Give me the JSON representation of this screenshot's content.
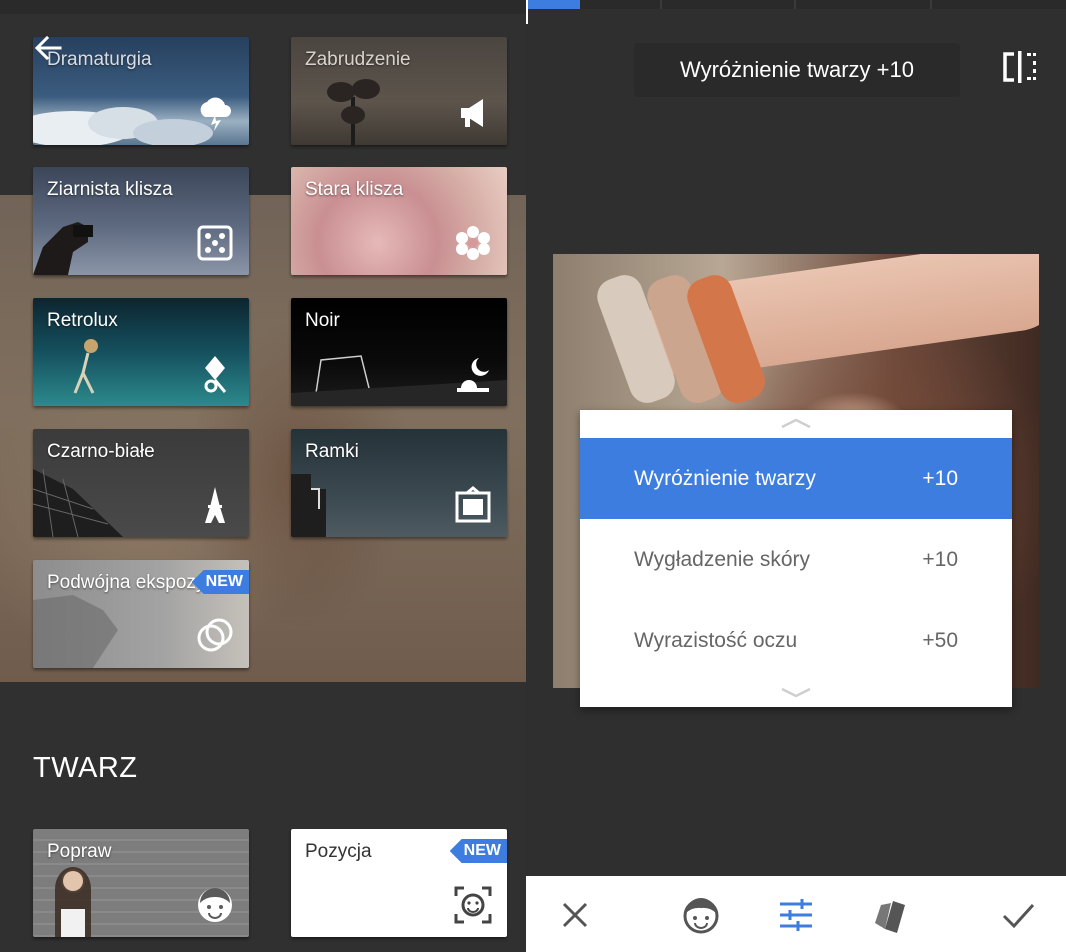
{
  "left": {
    "filters": [
      {
        "id": "dramaturgia",
        "label": "Dramaturgia",
        "icon": "cloud-lightning-icon"
      },
      {
        "id": "zabrudzenie",
        "label": "Zabrudzenie",
        "icon": "megaphone-icon"
      },
      {
        "id": "ziarnista",
        "label": "Ziarnista klisza",
        "icon": "dice-icon"
      },
      {
        "id": "stara",
        "label": "Stara klisza",
        "icon": "flower-icon"
      },
      {
        "id": "retrolux",
        "label": "Retrolux",
        "icon": "balloon-icon"
      },
      {
        "id": "noir",
        "label": "Noir",
        "icon": "moon-icon"
      },
      {
        "id": "czarno",
        "label": "Czarno-białe",
        "icon": "eiffel-tower-icon"
      },
      {
        "id": "ramki",
        "label": "Ramki",
        "icon": "frame-icon"
      },
      {
        "id": "podwojna",
        "label": "Podwójna ekspozycja",
        "icon": "overlap-circles-icon",
        "badge": "NEW"
      }
    ],
    "section_title": "TWARZ",
    "face_tools": [
      {
        "id": "popraw",
        "label": "Popraw",
        "icon": "face-icon"
      },
      {
        "id": "pozycja",
        "label": "Pozycja",
        "icon": "face-scan-icon",
        "badge": "NEW"
      }
    ]
  },
  "right": {
    "current_value": "Wyróżnienie twarzy +10",
    "menu": [
      {
        "label": "Wyróżnienie twarzy",
        "value": "+10",
        "active": true
      },
      {
        "label": "Wygładzenie skóry",
        "value": "+10",
        "active": false
      },
      {
        "label": "Wyrazistość oczu",
        "value": "+50",
        "active": false
      }
    ],
    "bottom_bar": [
      "close-icon",
      "face-icon",
      "sliders-icon",
      "styles-icon",
      "check-icon"
    ]
  },
  "colors": {
    "accent": "#3d7ddf",
    "panel": "#303030",
    "text": "#ffffff"
  }
}
